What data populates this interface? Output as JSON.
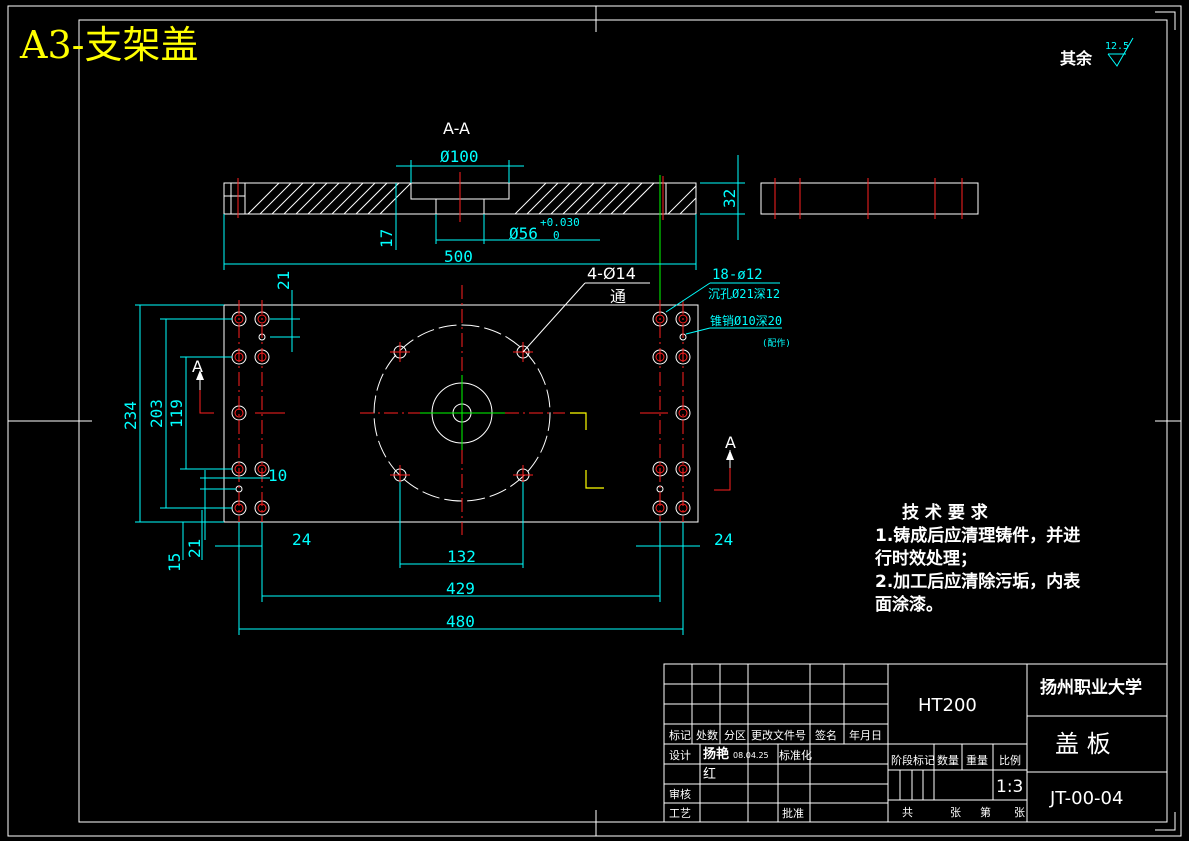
{
  "sheet": {
    "title": "A3-支架盖",
    "surface_finish": {
      "label": "其余",
      "value": "12.5"
    }
  },
  "section": {
    "label": "A-A",
    "dims": {
      "bore": "Ø100",
      "counterbore": "Ø56",
      "tol_upper": "+0.030",
      "tol_lower": "0",
      "thickness": "32",
      "depth": "17",
      "length": "500"
    }
  },
  "plan": {
    "callouts": {
      "holes_big": "4-Ø14",
      "holes_big_note": "通",
      "holes_small": "18-ø12",
      "holes_small_note": "沉孔Ø21深12",
      "pin": "锥销Ø10深20",
      "pin_note": "(配作)"
    },
    "dims": {
      "h234": "234",
      "h203": "203",
      "h119": "119",
      "d21_top": "21",
      "d10": "10",
      "d15": "15",
      "d21_bot": "21",
      "d24_left": "24",
      "d24_right": "24",
      "d132": "132",
      "d429": "429",
      "d480": "480"
    },
    "section_marker": "A"
  },
  "notes": {
    "heading": "技 术 要 求",
    "lines": [
      "1.铸成后应清理铸件，并进",
      "行时效处理；",
      "2.加工后应清除污垢，内表",
      "面涂漆。"
    ]
  },
  "title_block": {
    "material": "HT200",
    "school": "扬州职业大学",
    "part_name": "盖  板",
    "drawing_no": "JT-00-04",
    "scale": "1:3",
    "header_cells": [
      "标记",
      "处数",
      "分区",
      "更改文件号",
      "签名",
      "年月日"
    ],
    "design_label": "设计",
    "designer": "扬艳",
    "designer_2": "红",
    "design_date": "08.04.25",
    "std_label": "标准化",
    "check_label": "审核",
    "process_label": "工艺",
    "approve_label": "批准",
    "stage_cells": [
      "阶段标记",
      "数量",
      "重量",
      "比例"
    ],
    "sheet_cells": [
      "共",
      "张",
      "第",
      "张"
    ]
  }
}
